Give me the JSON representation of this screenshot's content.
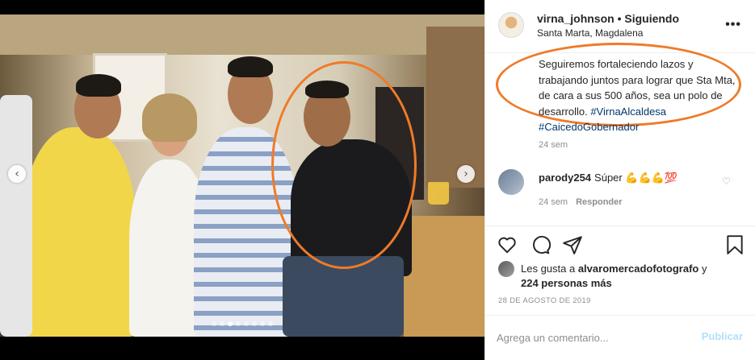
{
  "post": {
    "username": "virna_johnson",
    "follow_state": " • Siguiendo",
    "location": "Santa Marta, Magdalena",
    "more_icon": "more-horizontal-icon"
  },
  "caption": {
    "text": "Seguiremos fortaleciendo lazos y trabajando juntos para lograr que Sta Mta, de cara a sus 500 años, sea un polo de desarrollo.",
    "hashtags": "#VirnaAlcaldesa #CaicedoGobernador",
    "time": "24 sem"
  },
  "comment": {
    "user": "parody254",
    "text": "Súper 💪💪💪💯",
    "time": "24 sem",
    "reply_label": "Responder"
  },
  "likes": {
    "prefix": "Les gusta a ",
    "liker": "alvaromercadofotografo",
    "suffix": " y",
    "others": "224 personas más"
  },
  "post_date": "28 DE AGOSTO DE 2019",
  "comment_box": {
    "placeholder": "Agrega un comentario...",
    "publish_label": "Publicar"
  },
  "carousel": {
    "prev_icon": "‹",
    "next_icon": "›",
    "slide_count": 8,
    "active_slide": 3
  },
  "colors": {
    "annotation": "#ee7b2a",
    "hashtag": "#00376b",
    "publish_disabled": "#b2dffc"
  }
}
